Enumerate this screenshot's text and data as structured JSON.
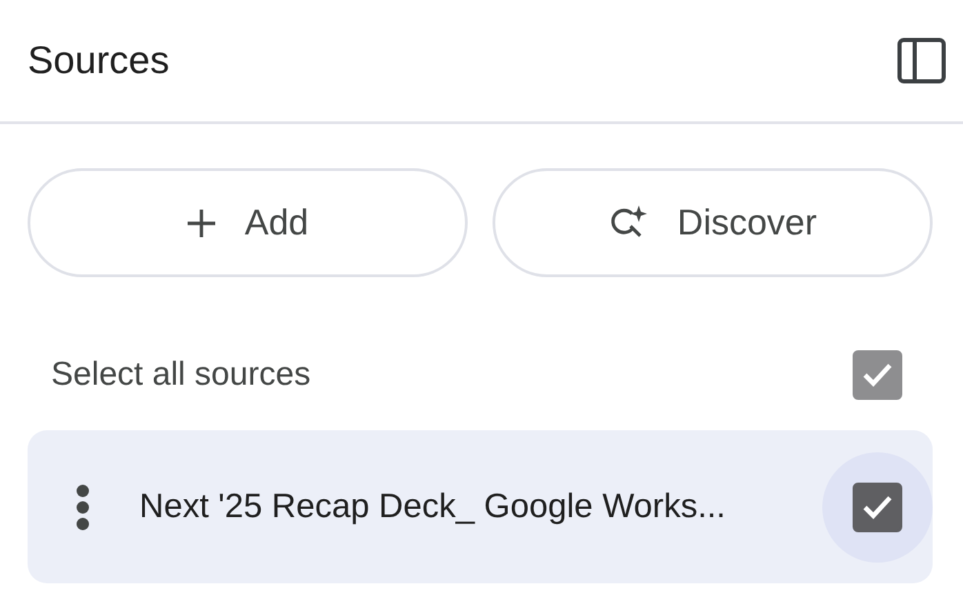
{
  "panel": {
    "title": "Sources"
  },
  "actions": [
    {
      "kind": "add",
      "label": "Add"
    },
    {
      "kind": "discover",
      "label": "Discover"
    }
  ],
  "select_all": {
    "label": "Select all sources",
    "checked": true
  },
  "sources": [
    {
      "title": "Next '25 Recap Deck_ Google Works...",
      "checked": true
    }
  ]
}
